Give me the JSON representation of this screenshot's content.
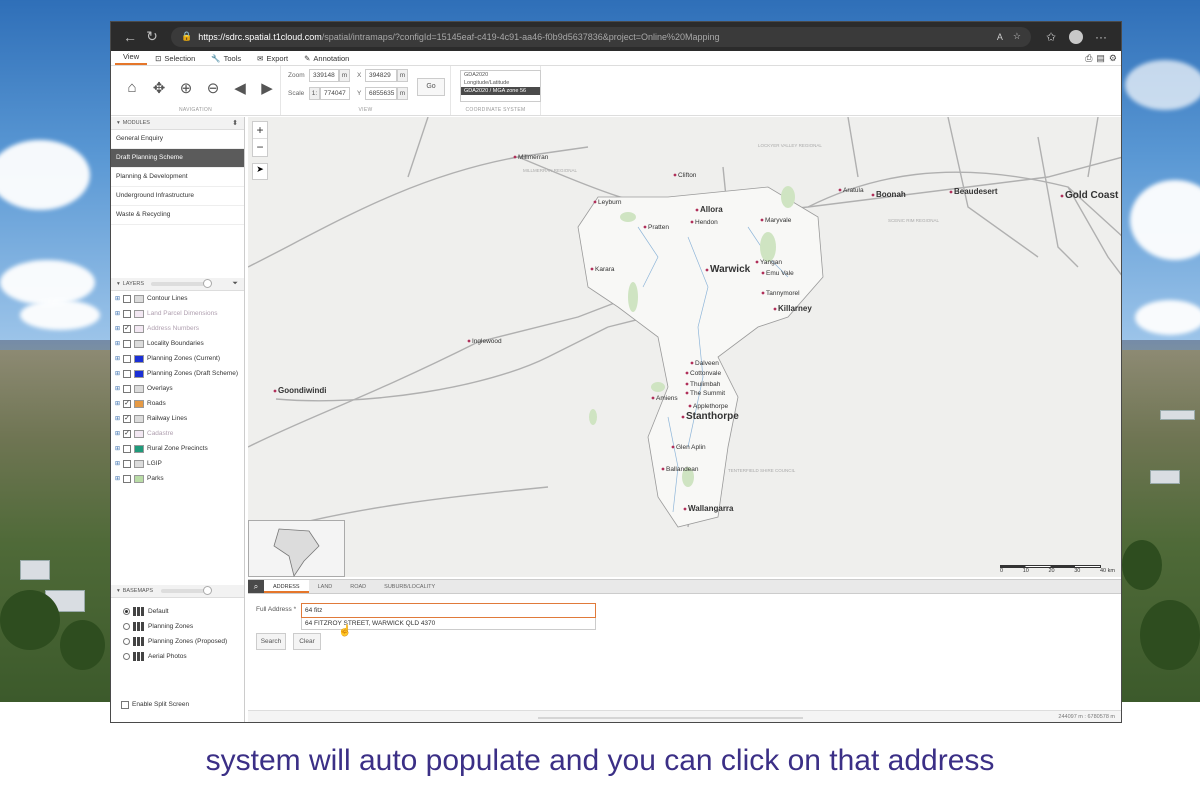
{
  "caption": "system will auto populate and you can click on that address",
  "browser": {
    "url_host": "https://sdrc.spatial.t1cloud.com",
    "url_path": "/spatial/intramaps/?configId=15145eaf-c419-4c91-aa46-f0b9d5637836&project=Online%20Mapping"
  },
  "menu": {
    "view": "View",
    "selection": "Selection",
    "tools": "Tools",
    "export": "Export",
    "annotation": "Annotation"
  },
  "ribbon": {
    "navigation_label": "NAVIGATION",
    "view_label": "VIEW",
    "crs_label": "COORDINATE SYSTEM",
    "zoom_label": "Zoom",
    "zoom_value": "339148",
    "zoom_unit": "m",
    "scale_label": "Scale",
    "scale_prefix": "1:",
    "scale_value": "774047",
    "x_label": "X",
    "x_value": "394829",
    "x_unit": "m",
    "y_label": "Y",
    "y_value": "6855635",
    "y_unit": "m",
    "go": "Go",
    "crs_options": [
      "GDA2020",
      "Longitude/Latitude",
      "GDA2020 / MGA zone 56"
    ],
    "crs_selected": "GDA2020 / MGA zone 56"
  },
  "modules": {
    "header": "MODULES",
    "items": [
      "General Enquiry",
      "Draft Planning Scheme",
      "Planning & Development",
      "Underground Infrastructure",
      "Waste & Recycling"
    ],
    "active_index": 1
  },
  "layers": {
    "header": "LAYERS",
    "items": [
      {
        "label": "Contour Lines",
        "checked": false
      },
      {
        "label": "Land Parcel Dimensions",
        "checked": false,
        "muted": true
      },
      {
        "label": "Address Numbers",
        "checked": true,
        "muted": true
      },
      {
        "label": "Locality Boundaries",
        "checked": false
      },
      {
        "label": "Planning Zones (Current)",
        "checked": false,
        "color": "#1a2fd6"
      },
      {
        "label": "Planning Zones (Draft Scheme)",
        "checked": false,
        "color": "#1a2fd6"
      },
      {
        "label": "Overlays",
        "checked": false
      },
      {
        "label": "Roads",
        "checked": true,
        "color": "#e69a45"
      },
      {
        "label": "Railway Lines",
        "checked": true
      },
      {
        "label": "Cadastre",
        "checked": true,
        "muted": true
      },
      {
        "label": "Rural Zone Precincts",
        "checked": false,
        "color": "#1f9a7a"
      },
      {
        "label": "LGIP",
        "checked": false
      },
      {
        "label": "Parks",
        "checked": false,
        "color": "#b9dca6"
      }
    ]
  },
  "basemaps": {
    "header": "BASEMAPS",
    "items": [
      "Default",
      "Planning Zones",
      "Planning Zones (Proposed)",
      "Aerial Photos"
    ],
    "selected_index": 0,
    "split_screen": "Enable Split Screen"
  },
  "map": {
    "places": [
      {
        "name": "Millmerran",
        "size": "s"
      },
      {
        "name": "Clifton",
        "size": "s"
      },
      {
        "name": "Leyburn",
        "size": "s"
      },
      {
        "name": "Allora",
        "size": "m"
      },
      {
        "name": "Hendon",
        "size": "s"
      },
      {
        "name": "Pratten",
        "size": "s"
      },
      {
        "name": "Maryvale",
        "size": "s"
      },
      {
        "name": "Aratula",
        "size": "s"
      },
      {
        "name": "Boonah",
        "size": "m"
      },
      {
        "name": "Beaudesert",
        "size": "m"
      },
      {
        "name": "Gold Coast",
        "size": "l"
      },
      {
        "name": "Warwick",
        "size": "l"
      },
      {
        "name": "Karara",
        "size": "s"
      },
      {
        "name": "Yangan",
        "size": "s"
      },
      {
        "name": "Emu Vale",
        "size": "s"
      },
      {
        "name": "Tannymorel",
        "size": "s"
      },
      {
        "name": "Killarney",
        "size": "m"
      },
      {
        "name": "Inglewood",
        "size": "s"
      },
      {
        "name": "Goondiwindi",
        "size": "m"
      },
      {
        "name": "Dalveen",
        "size": "s"
      },
      {
        "name": "Cottonvale",
        "size": "s"
      },
      {
        "name": "Thulimbah",
        "size": "s"
      },
      {
        "name": "The Summit",
        "size": "s"
      },
      {
        "name": "Amiens",
        "size": "s"
      },
      {
        "name": "Applethorpe",
        "size": "s"
      },
      {
        "name": "Stanthorpe",
        "size": "l"
      },
      {
        "name": "Glen Aplin",
        "size": "s"
      },
      {
        "name": "Ballandean",
        "size": "s"
      },
      {
        "name": "Wallangarra",
        "size": "m"
      }
    ],
    "regions": [
      "MILLMERRAN REGIONAL",
      "LOCKYER VALLEY REGIONAL",
      "SCENIC RIM REGIONAL",
      "TENTERFIELD SHIRE COUNCIL"
    ],
    "scale_labels": [
      "0",
      "10",
      "20",
      "30",
      "40 km"
    ]
  },
  "search": {
    "tabs": [
      "ADDRESS",
      "LAND",
      "ROAD",
      "SUBURB/LOCALITY"
    ],
    "active_tab": 0,
    "field_label": "Full Address *",
    "field_value": "64 fitz",
    "suggestion": "64 FITZROY STREET, WARWICK QLD 4370",
    "search_button": "Search",
    "clear_button": "Clear"
  },
  "status": {
    "coords": "244097 m : 6780578 m"
  },
  "colors": {
    "accent": "#e5762a",
    "active_module": "#5b5b5b",
    "caption": "#3b2f86"
  }
}
